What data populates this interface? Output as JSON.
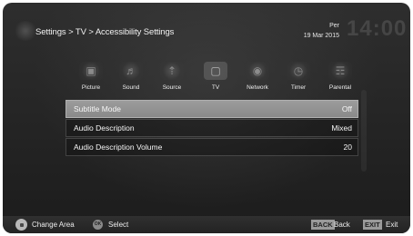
{
  "header": {
    "breadcrumb": "Settings > TV > Accessibility Settings",
    "day": "Per",
    "date": "19 Mar 2015",
    "time": "14:00"
  },
  "categories": [
    {
      "label": "Picture",
      "icon": "picture-icon",
      "active": false
    },
    {
      "label": "Sound",
      "icon": "sound-icon",
      "active": false
    },
    {
      "label": "Source",
      "icon": "source-icon",
      "active": false
    },
    {
      "label": "TV",
      "icon": "tv-icon",
      "active": true
    },
    {
      "label": "Network",
      "icon": "network-icon",
      "active": false
    },
    {
      "label": "Timer",
      "icon": "timer-icon",
      "active": false
    },
    {
      "label": "Parental",
      "icon": "parental-icon",
      "active": false
    }
  ],
  "settings": [
    {
      "name": "Subtitle Mode",
      "value": "Off",
      "selected": true
    },
    {
      "name": "Audio Description",
      "value": "Mixed",
      "selected": false
    },
    {
      "name": "Audio Description Volume",
      "value": "20",
      "selected": false
    }
  ],
  "footer": {
    "change_area": "Change Area",
    "ok_key": "OK",
    "select": "Select",
    "back_key": "BACK",
    "back": "Back",
    "exit_key": "EXIT",
    "exit": "Exit"
  },
  "colors": {
    "background": "#262626",
    "selected_row": "#9c9c9c",
    "text": "#f5f5f5"
  }
}
